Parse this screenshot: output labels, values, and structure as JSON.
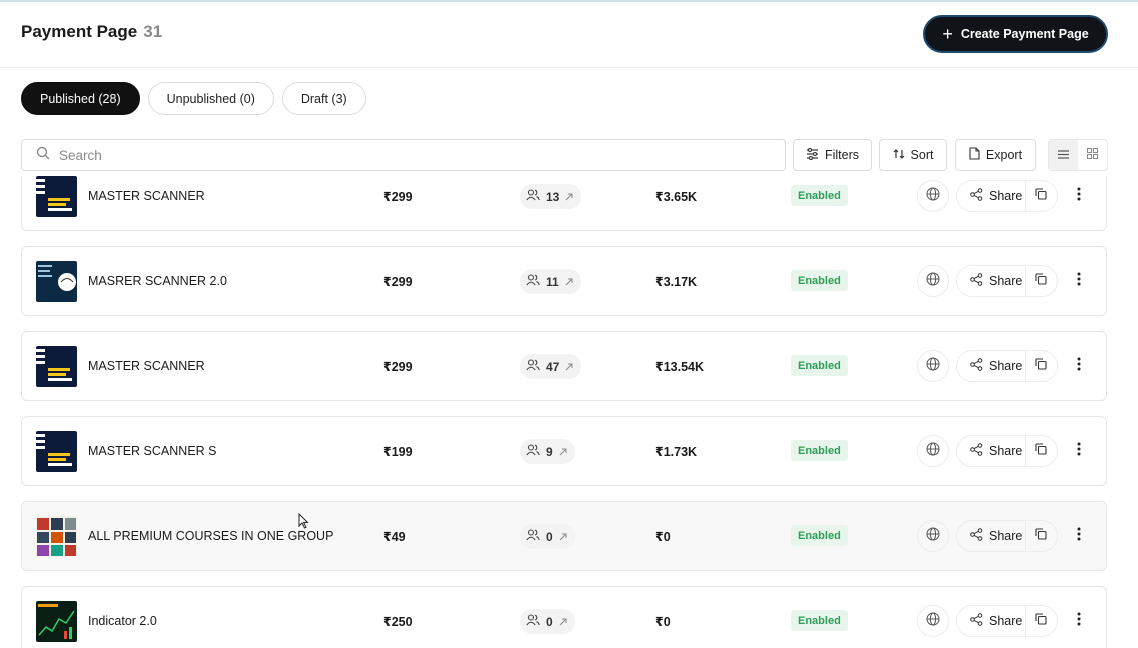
{
  "header": {
    "title": "Payment Page",
    "count": "31",
    "create_button_label": "Create Payment Page"
  },
  "tabs": [
    {
      "label": "Published (28)",
      "active": true
    },
    {
      "label": "Unpublished (0)",
      "active": false
    },
    {
      "label": "Draft (3)",
      "active": false
    }
  ],
  "toolbar": {
    "search_placeholder": "Search",
    "filters_label": "Filters",
    "sort_label": "Sort",
    "export_label": "Export"
  },
  "rows": [
    {
      "name": "MASTER SCANNER",
      "price": "₹299",
      "buyers": "13",
      "revenue": "₹3.65K",
      "status": "Enabled",
      "share_label": "Share",
      "thumb": "scanner"
    },
    {
      "name": "MASRER SCANNER 2.0",
      "price": "₹299",
      "buyers": "11",
      "revenue": "₹3.17K",
      "status": "Enabled",
      "share_label": "Share",
      "thumb": "scanner2"
    },
    {
      "name": "MASTER SCANNER",
      "price": "₹299",
      "buyers": "47",
      "revenue": "₹13.54K",
      "status": "Enabled",
      "share_label": "Share",
      "thumb": "scanner"
    },
    {
      "name": "MASTER SCANNER S",
      "price": "₹199",
      "buyers": "9",
      "revenue": "₹1.73K",
      "status": "Enabled",
      "share_label": "Share",
      "thumb": "scanner"
    },
    {
      "name": "ALL PREMIUM COURSES IN ONE GROUP",
      "price": "₹49",
      "buyers": "0",
      "revenue": "₹0",
      "status": "Enabled",
      "share_label": "Share",
      "thumb": "courses"
    },
    {
      "name": "Indicator 2.0",
      "price": "₹250",
      "buyers": "0",
      "revenue": "₹0",
      "status": "Enabled",
      "share_label": "Share",
      "thumb": "indicator"
    }
  ],
  "colors": {
    "accent_dark": "#101418",
    "status_green": "#2f9e57",
    "status_bg": "#e7f5ec"
  }
}
